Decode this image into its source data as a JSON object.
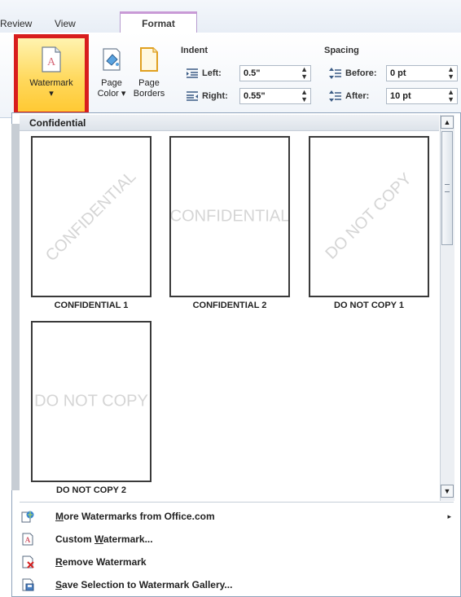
{
  "tabs": {
    "review": "Review",
    "view": "View",
    "format": "Format"
  },
  "ribbon": {
    "watermark": {
      "label": "Watermark",
      "arrow": "▾"
    },
    "page_color": {
      "line1": "Page",
      "line2": "Color ▾"
    },
    "page_borders": {
      "line1": "Page",
      "line2": "Borders"
    },
    "indent": {
      "header": "Indent",
      "left_label": "Left:",
      "left_value": "0.5\"",
      "right_label": "Right:",
      "right_value": "0.55\""
    },
    "spacing": {
      "header": "Spacing",
      "before_label": "Before:",
      "before_value": "0 pt",
      "after_label": "After:",
      "after_value": "10 pt"
    }
  },
  "gallery": {
    "section_header": "Confidential",
    "items": [
      {
        "caption": "CONFIDENTIAL 1",
        "text": "CONFIDENTIAL"
      },
      {
        "caption": "CONFIDENTIAL 2",
        "text": "CONFIDENTIAL"
      },
      {
        "caption": "DO NOT COPY 1",
        "text": "DO NOT COPY"
      },
      {
        "caption": "DO NOT COPY 2",
        "text": "DO NOT COPY"
      }
    ]
  },
  "menu": {
    "more": {
      "first": "M",
      "rest": "ore Watermarks from Office.com"
    },
    "custom": {
      "pre": "Custom ",
      "u": "W",
      "post": "atermark..."
    },
    "remove": {
      "first": "R",
      "rest": "emove Watermark"
    },
    "save": {
      "first": "S",
      "rest": "ave Selection to Watermark Gallery..."
    }
  },
  "colors": {
    "highlight": "#d81d1d",
    "accent_tab": "#c99ad6"
  }
}
